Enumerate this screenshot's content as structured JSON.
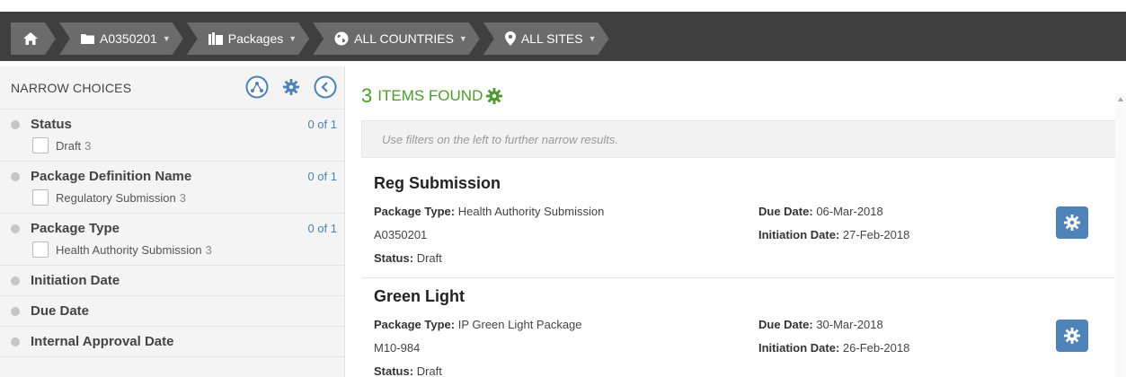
{
  "breadcrumbs": [
    {
      "label": "A0350201"
    },
    {
      "label": "Packages"
    },
    {
      "label": "ALL COUNTRIES"
    },
    {
      "label": "ALL SITES"
    }
  ],
  "sidebar": {
    "title": "NARROW CHOICES",
    "facets": [
      {
        "label": "Status",
        "count": "0 of 1",
        "options": [
          {
            "label": "Draft",
            "n": "3"
          }
        ]
      },
      {
        "label": "Package Definition Name",
        "count": "0 of 1",
        "options": [
          {
            "label": "Regulatory Submission",
            "n": "3"
          }
        ]
      },
      {
        "label": "Package Type",
        "count": "0 of 1",
        "options": [
          {
            "label": "Health Authority Submission",
            "n": "3"
          }
        ]
      },
      {
        "label": "Initiation Date"
      },
      {
        "label": "Due Date"
      },
      {
        "label": "Internal Approval Date"
      }
    ]
  },
  "results_header": {
    "count": "3",
    "label": "ITEMS FOUND"
  },
  "hint": "Use filters on the left to further narrow results.",
  "labels": {
    "package_type": "Package Type:",
    "status": "Status:",
    "due_date": "Due Date:",
    "initiation_date": "Initiation Date:"
  },
  "results": [
    {
      "name": "Reg Submission",
      "package_type": "Health Authority Submission",
      "code": "A0350201",
      "status": "Draft",
      "due_date": "06-Mar-2018",
      "initiation_date": "27-Feb-2018"
    },
    {
      "name": "Green Light",
      "package_type": "IP Green Light Package",
      "code": "M10-984",
      "status": "Draft",
      "due_date": "30-Mar-2018",
      "initiation_date": "26-Feb-2018"
    }
  ],
  "colors": {
    "accent_blue": "#4f82b7",
    "accent_green": "#4d9b2f",
    "topbar": "#3f3f3f"
  }
}
